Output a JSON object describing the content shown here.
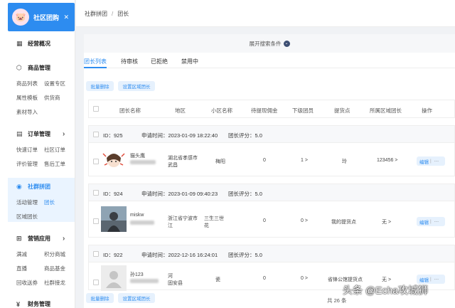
{
  "sidebar": {
    "brand": "社区团购",
    "groups": [
      {
        "label": "经营概况",
        "icon": "chart-icon"
      },
      {
        "label": "商品管理",
        "icon": "cube-icon"
      },
      {
        "label": "订单管理",
        "icon": "order-icon"
      },
      {
        "label": "社群拼团",
        "icon": "group-icon"
      },
      {
        "label": "营销应用",
        "icon": "grid-icon"
      },
      {
        "label": "财务管理",
        "icon": "finance-icon"
      }
    ],
    "goods_items": [
      "商品列表",
      "设置专区",
      "属性模板",
      "供货商",
      "素材导入"
    ],
    "order_items": [
      "快速订单",
      "社区订单",
      "评价管理",
      "售后工单"
    ],
    "group_items": [
      "活动管理",
      "团长",
      "区域团长"
    ],
    "marketing_items": [
      "满减",
      "积分商城",
      "直播",
      "商品基金",
      "回收送券",
      "社群接龙"
    ]
  },
  "breadcrumb": {
    "root": "社群拼团",
    "sep": "/",
    "current": "团长"
  },
  "search": {
    "expand_label": "展开搜索条件",
    "expand_icon": "chevron-down-icon"
  },
  "tabs": [
    "团长列表",
    "待审核",
    "已拒绝",
    "禁用中"
  ],
  "buttons": {
    "batch_delete": "批量删除",
    "set_region": "设置区域团长"
  },
  "table": {
    "headers": [
      "团长名称",
      "地区",
      "小区名称",
      "待提现佣金",
      "下级团员",
      "提货点",
      "所属区域团长",
      "操作"
    ]
  },
  "rows": [
    {
      "id": "ID：925",
      "apply_time": "申请时间：2023-01-09 18:22:40",
      "score": "团长评分：5.0",
      "name": "猫头鹰",
      "region": "湖北省孝感市",
      "region2": "武昌",
      "community": "梅阳",
      "commission": "0",
      "members": "1 >",
      "pickup": "玲",
      "area_leader": "123456 >",
      "edit": "编辑",
      "more": "···"
    },
    {
      "id": "ID：924",
      "apply_time": "申请时间：2023-01-09 09:40:23",
      "score": "团长评分：5.0",
      "name": "miskw",
      "region": "浙江省宁波市",
      "region2": "江",
      "community": "三生三世",
      "community2": "花",
      "commission": "0",
      "members": "0 >",
      "pickup": "我的提货点",
      "area_leader": "无 >",
      "edit": "编辑",
      "more": "···"
    },
    {
      "id": "ID：922",
      "apply_time": "申请时间：2022-12-16 16:24:01",
      "score": "团长评分：5.0",
      "name": "孙123",
      "region": "河",
      "region2": "固安县",
      "community": "瓷",
      "commission": "0",
      "members": "0 >",
      "pickup": "省锋公馆提货点",
      "area_leader": "无 >",
      "edit": "编辑",
      "more": "···"
    }
  ],
  "pager": {
    "total": "共 26 条"
  },
  "watermark": "头条 @Echa攻城狮"
}
